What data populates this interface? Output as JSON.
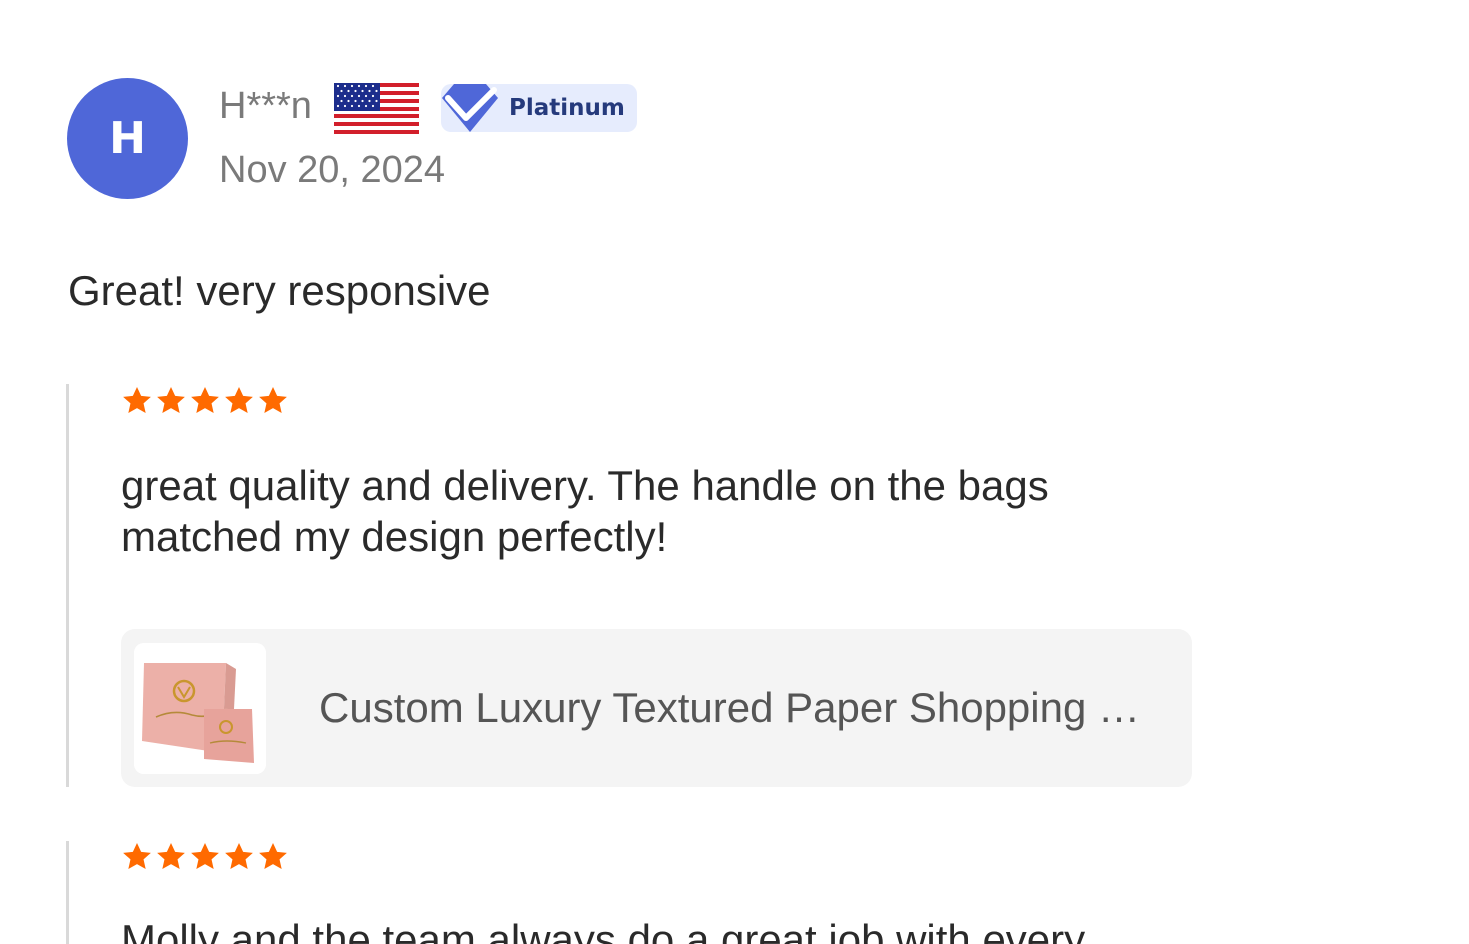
{
  "review": {
    "avatar_initial": "H",
    "username": "H***n",
    "country_flag_icon": "us-flag-icon",
    "badge": {
      "label": "Platinum",
      "icon": "verified-check-icon",
      "color": "#4f67d8"
    },
    "date": "Nov 20, 2024",
    "summary": "Great! very responsive"
  },
  "sub_reviews": [
    {
      "rating": 5,
      "max_rating": 5,
      "star_color": "#ff6a00",
      "comment": "great quality and delivery. The handle on the bags matched my design perfectly!",
      "product": {
        "title": "Custom Luxury Textured Paper Shopping Bags",
        "thumbnail": "pink-paper-shopping-bags-image"
      }
    },
    {
      "rating": 5,
      "max_rating": 5,
      "star_color": "#ff6a00",
      "comment": "Molly and the team always do a great job with every"
    }
  ],
  "colors": {
    "avatar_bg": "#4f67d8",
    "badge_bg": "#e6ecfd",
    "badge_text": "#253a7c",
    "star": "#ff6a00",
    "muted_text": "#7a7a7a",
    "card_bg": "#f4f4f4"
  }
}
